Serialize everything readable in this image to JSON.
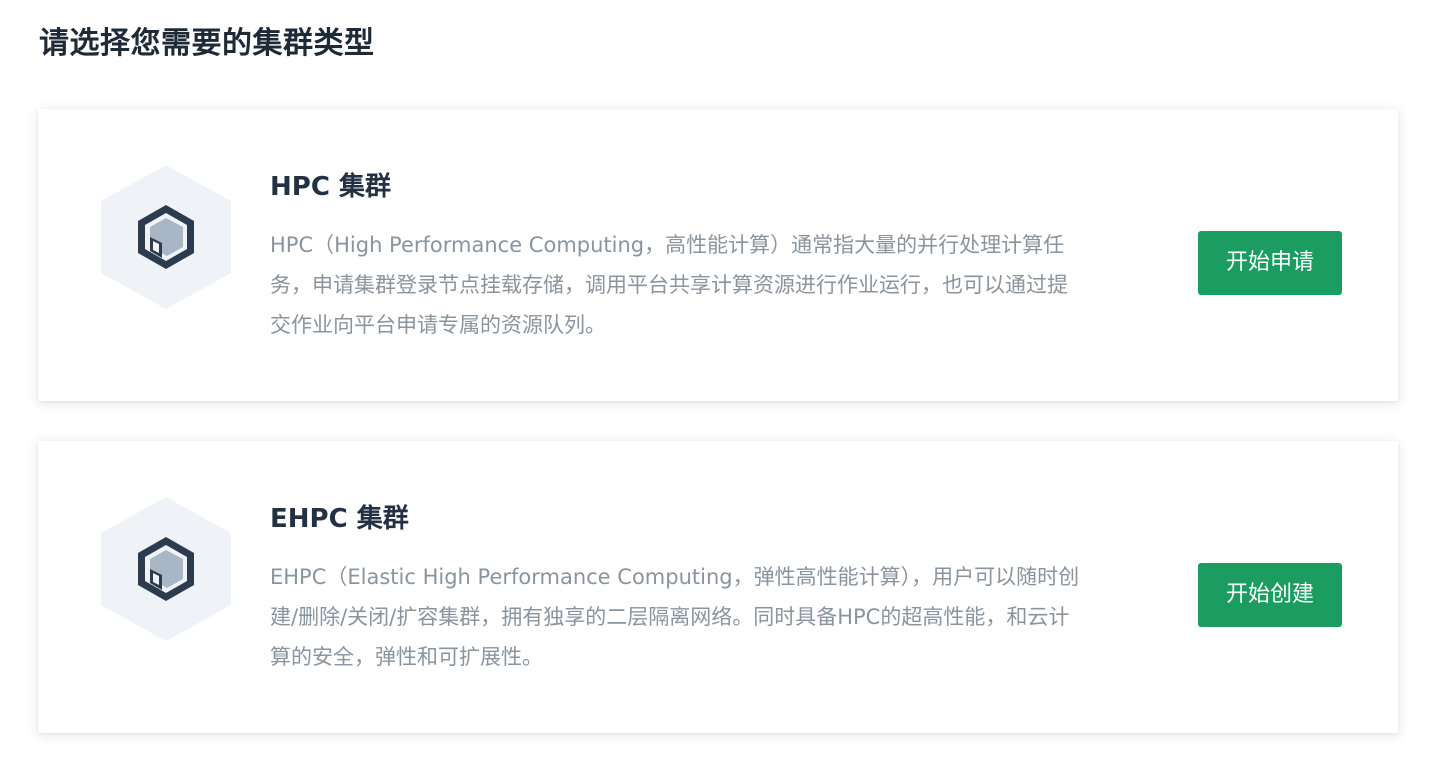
{
  "page": {
    "title": "请选择您需要的集群类型"
  },
  "cards": [
    {
      "title": "HPC 集群",
      "description": "HPC（High Performance Computing，高性能计算）通常指大量的并行处理计算任务，申请集群登录节点挂载存储，调用平台共享计算资源进行作业运行，也可以通过提交作业向平台申请专属的资源队列。",
      "button_label": "开始申请",
      "icon": "cluster-cube-icon"
    },
    {
      "title": "EHPC 集群",
      "description": "EHPC（Elastic High Performance Computing，弹性高性能计算），用户可以随时创建/删除/关闭/扩容集群，拥有独享的二层隔离网络。同时具备HPC的超高性能，和云计算的安全，弹性和可扩展性。",
      "button_label": "开始创建",
      "icon": "cluster-cube-icon"
    }
  ],
  "colors": {
    "accent_button": "#1b9d61",
    "title_text": "#1f2a37",
    "body_text": "#8a949e",
    "icon_hex_bg": "#eff3f8",
    "icon_dark": "#2c3b4d",
    "icon_light": "#a9b6c6"
  }
}
